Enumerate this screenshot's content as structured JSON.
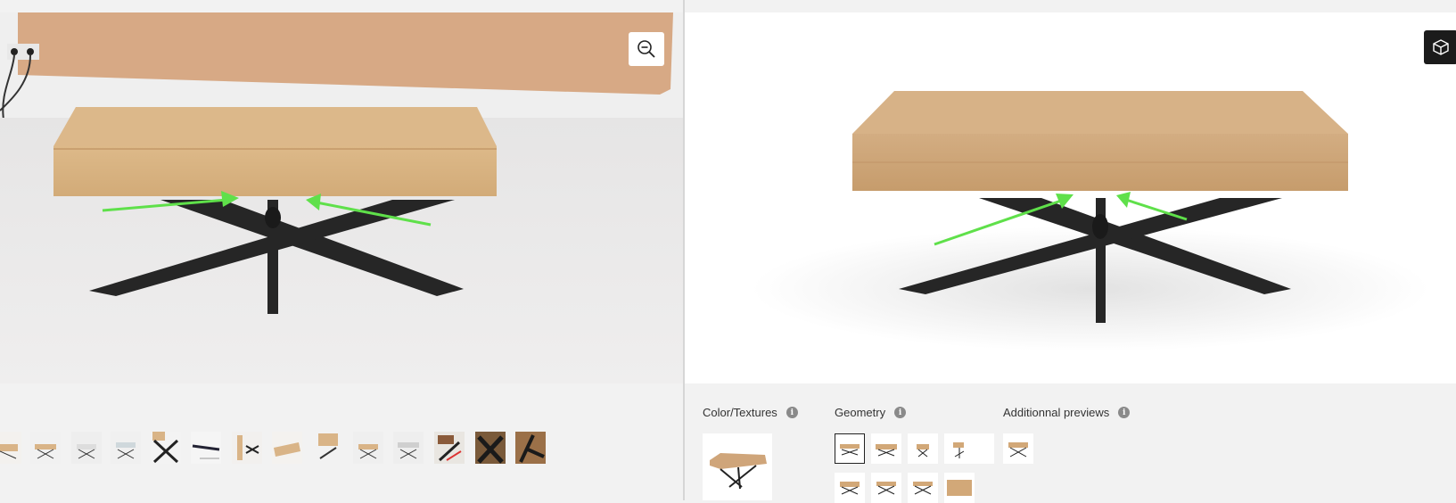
{
  "photo_viewer": {
    "zoom_button_icon": "zoom-out-icon",
    "thumbnails_count": 14
  },
  "render_viewer": {
    "view_3d_button_icon": "cube-icon"
  },
  "sections": {
    "textures": {
      "title": "Color/Textures"
    },
    "geometry": {
      "title": "Geometry"
    },
    "previews": {
      "title": "Additionnal previews"
    }
  },
  "colors": {
    "wood": "#d9b487",
    "wood_dark": "#c49a6a",
    "metal": "#262626",
    "arrow": "#5fe04a",
    "background_paper": "#d7a985"
  }
}
